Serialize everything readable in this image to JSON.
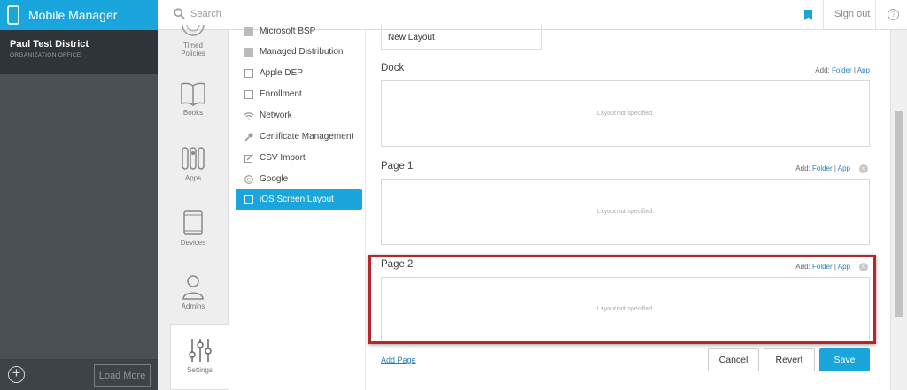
{
  "app": {
    "title": "Mobile Manager"
  },
  "org": {
    "name": "Paul Test District",
    "subtitle": "ORGANIZATION OFFICE"
  },
  "sidebar_bottom": {
    "load_more": "Load More"
  },
  "topbar": {
    "search_placeholder": "Search",
    "sign_out": "Sign out"
  },
  "nav": {
    "timed_policies_line1": "Timed",
    "timed_policies_line2": "Policies",
    "books": "Books",
    "apps": "Apps",
    "devices": "Devices",
    "admins": "Admins",
    "settings": "Settings"
  },
  "menu": {
    "items": [
      {
        "label": "Microsoft BSP",
        "icon": "puzzle-icon"
      },
      {
        "label": "Managed Distribution",
        "icon": "copy-icon"
      },
      {
        "label": "Apple DEP",
        "icon": "square-icon"
      },
      {
        "label": "Enrollment",
        "icon": "tablet-icon"
      },
      {
        "label": "Network",
        "icon": "wifi-icon"
      },
      {
        "label": "Certificate Management",
        "icon": "key-icon"
      },
      {
        "label": "CSV Import",
        "icon": "edit-icon"
      },
      {
        "label": "Google",
        "icon": "google-icon"
      },
      {
        "label": "iOS Screen Layout",
        "icon": "tablet-icon",
        "active": true
      }
    ]
  },
  "main": {
    "layout_name": "New Layout",
    "add_label": "Add:",
    "folder_link": "Folder",
    "divider": "|",
    "app_link": "App",
    "empty_text": "Layout not specified.",
    "sections": [
      {
        "title": "Dock"
      },
      {
        "title": "Page 1"
      },
      {
        "title": "Page 2"
      }
    ],
    "add_page": "Add Page",
    "buttons": {
      "cancel": "Cancel",
      "revert": "Revert",
      "save": "Save"
    }
  },
  "colors": {
    "accent": "#1aa6dd",
    "highlight": "#b3282d",
    "sidebar": "#4a4f54"
  }
}
